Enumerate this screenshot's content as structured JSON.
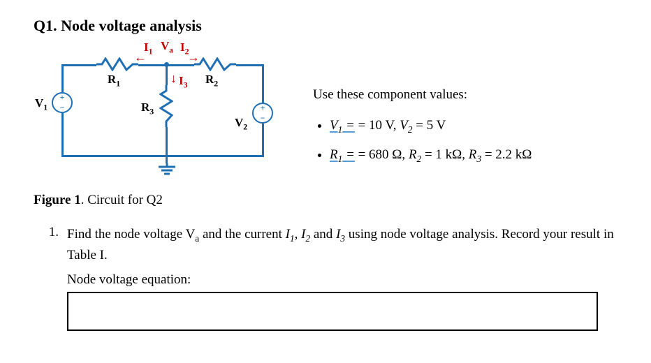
{
  "title": "Q1. Node voltage analysis",
  "figure": {
    "caption_bold": "Figure 1",
    "caption_rest": ". Circuit for Q2",
    "labels": {
      "V1": "V",
      "V1_sub": "1",
      "V2": "V",
      "V2_sub": "2",
      "R1": "R",
      "R1_sub": "1",
      "R2": "R",
      "R2_sub": "2",
      "R3": "R",
      "R3_sub": "3",
      "I1": "I",
      "I1_sub": "1",
      "I2": "I",
      "I2_sub": "2",
      "I3": "I",
      "I3_sub": "3",
      "Va": "V",
      "Va_sub": "a"
    }
  },
  "values": {
    "heading": "Use these component values:",
    "line1_pre": "V",
    "line1_sub1": "1",
    "line1_mid": " = 10 V, ",
    "line1_v2": "V",
    "line1_sub2": "2",
    "line1_end": "  = 5 V",
    "line2_pre": "R",
    "line2_sub1": "1",
    "line2_mid1": " = 680 Ω, ",
    "line2_r2": "R",
    "line2_sub2": "2",
    "line2_mid2": "  = 1 kΩ, ",
    "line2_r3": "R",
    "line2_sub3": "3",
    "line2_end": "  = 2.2 kΩ"
  },
  "task": {
    "number": "1.",
    "text_a": "Find the node voltage V",
    "text_a_sub": "a",
    "text_b": " and the current ",
    "i1": "I",
    "i1_sub": "1",
    "comma1": ", ",
    "i2": "I",
    "i2_sub": "2",
    "and": " and ",
    "i3": "I",
    "i3_sub": "3",
    "text_c": " using node voltage analysis. Record your result in Table I."
  },
  "nveq_label": "Node voltage equation:"
}
